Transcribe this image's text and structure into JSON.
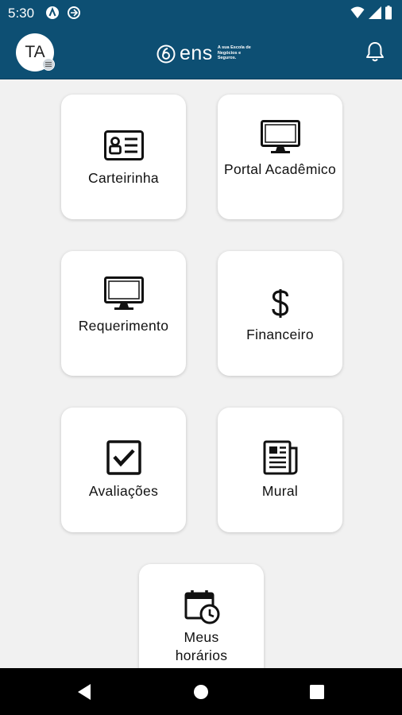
{
  "status_bar": {
    "time": "5:30"
  },
  "header": {
    "avatar_initials": "TA",
    "logo_text": "ens",
    "logo_tagline": "A sua Escola de Negócios e Seguros."
  },
  "menu": {
    "items": [
      {
        "label": "Carteirinha",
        "icon": "id-card-icon"
      },
      {
        "label": "Portal Acadêmico",
        "icon": "monitor-icon"
      },
      {
        "label": "Requerimento",
        "icon": "monitor-icon"
      },
      {
        "label": "Financeiro",
        "icon": "dollar-icon"
      },
      {
        "label": "Avaliações",
        "icon": "checkbox-icon"
      },
      {
        "label": "Mural",
        "icon": "newspaper-icon"
      },
      {
        "label": "Meus horários",
        "icon": "calendar-clock-icon"
      }
    ]
  }
}
